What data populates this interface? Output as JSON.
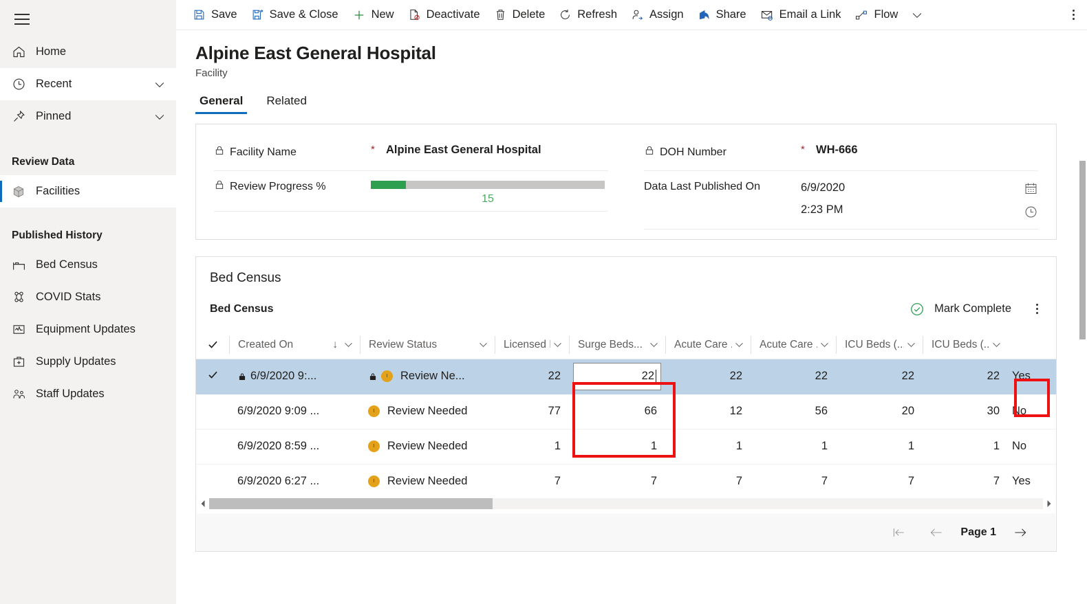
{
  "sidebar": {
    "hamburger_label": "menu-toggle",
    "nav": [
      {
        "label": "Home",
        "icon": "home-icon",
        "chevron": false
      },
      {
        "label": "Recent",
        "icon": "clock-icon",
        "chevron": true
      },
      {
        "label": "Pinned",
        "icon": "pin-icon",
        "chevron": true
      }
    ],
    "groups": [
      {
        "title": "Review Data",
        "items": [
          {
            "label": "Facilities",
            "icon": "cube-icon",
            "selected": true
          }
        ]
      },
      {
        "title": "Published History",
        "items": [
          {
            "label": "Bed Census",
            "icon": "bed-icon",
            "selected": false
          },
          {
            "label": "COVID Stats",
            "icon": "virus-icon",
            "selected": false
          },
          {
            "label": "Equipment Updates",
            "icon": "monitor-icon",
            "selected": false
          },
          {
            "label": "Supply Updates",
            "icon": "medkit-icon",
            "selected": false
          },
          {
            "label": "Staff Updates",
            "icon": "people-icon",
            "selected": false
          }
        ]
      }
    ]
  },
  "commandbar": {
    "items": [
      {
        "label": "Save",
        "icon": "save-icon"
      },
      {
        "label": "Save & Close",
        "icon": "save-close-icon"
      },
      {
        "label": "New",
        "icon": "plus-icon"
      },
      {
        "label": "Deactivate",
        "icon": "deactivate-icon"
      },
      {
        "label": "Delete",
        "icon": "trash-icon"
      },
      {
        "label": "Refresh",
        "icon": "refresh-icon"
      },
      {
        "label": "Assign",
        "icon": "assign-person-icon"
      },
      {
        "label": "Share",
        "icon": "share-icon"
      },
      {
        "label": "Email a Link",
        "icon": "email-link-icon"
      },
      {
        "label": "Flow",
        "icon": "flow-icon"
      }
    ],
    "overflow_label": "more-commands"
  },
  "record": {
    "title": "Alpine East General Hospital",
    "subtitle": "Facility",
    "tabs": [
      {
        "label": "General",
        "active": true
      },
      {
        "label": "Related",
        "active": false
      }
    ]
  },
  "form": {
    "left": [
      {
        "label": "Facility Name",
        "locked": true,
        "required": "*",
        "value": "Alpine East General Hospital",
        "type": "text"
      },
      {
        "label": "Review Progress %",
        "locked": true,
        "required": "",
        "value": "15",
        "type": "progress",
        "percent": 15
      }
    ],
    "right": [
      {
        "label": "DOH Number",
        "locked": true,
        "required": "*",
        "value": "WH-666",
        "type": "text"
      },
      {
        "label": "Data Last Published On",
        "locked": false,
        "required": "",
        "date": "6/9/2020",
        "time": "2:23 PM",
        "type": "datetime",
        "date_icon": "calendar-icon",
        "time_icon": "clock-icon"
      }
    ]
  },
  "grid": {
    "section_title": "Bed Census",
    "subgrid_title": "Bed Census",
    "mark_complete_label": "Mark Complete",
    "mark_complete_icon": "check-circle-icon",
    "more_label": "subgrid-more-commands",
    "columns": [
      {
        "key": "check",
        "label": "",
        "sort": "",
        "chevron": false,
        "type": "check"
      },
      {
        "key": "created_on",
        "label": "Created On",
        "sort": "↓",
        "chevron": true,
        "type": "text"
      },
      {
        "key": "review_status",
        "label": "Review Status",
        "sort": "",
        "chevron": true,
        "type": "text"
      },
      {
        "key": "licensed_beds",
        "label": "Licensed B...",
        "sort": "",
        "chevron": true,
        "type": "num"
      },
      {
        "key": "surge_beds",
        "label": "Surge Beds...",
        "sort": "",
        "chevron": true,
        "type": "num",
        "highlighted": true
      },
      {
        "key": "acute_care_1",
        "label": "Acute Care ...",
        "sort": "",
        "chevron": true,
        "type": "num"
      },
      {
        "key": "acute_care_2",
        "label": "Acute Care ...",
        "sort": "",
        "chevron": true,
        "type": "num"
      },
      {
        "key": "icu_beds_1",
        "label": "ICU Beds (...",
        "sort": "",
        "chevron": true,
        "type": "num"
      },
      {
        "key": "icu_beds_2",
        "label": "ICU Beds (...",
        "sort": "",
        "chevron": true,
        "type": "num"
      },
      {
        "key": "yesno",
        "label": "",
        "sort": "",
        "chevron": false,
        "type": "text"
      },
      {
        "key": "saveaction",
        "label": "",
        "sort": "",
        "chevron": false,
        "type": "save",
        "icon": "save-icon"
      }
    ],
    "rows": [
      {
        "selected": true,
        "checked": true,
        "locked_date": true,
        "locked_status": true,
        "created_on": "6/9/2020 9:...",
        "review_status": "Review Ne...",
        "status_icon": "clock-badge-icon",
        "licensed_beds": "22",
        "surge_beds": "22",
        "surge_beds_editing": true,
        "acute_care_1": "22",
        "acute_care_2": "22",
        "icu_beds_1": "22",
        "icu_beds_2": "22",
        "yesno": "Yes"
      },
      {
        "selected": false,
        "checked": false,
        "locked_date": false,
        "locked_status": false,
        "created_on": "6/9/2020 9:09 ...",
        "review_status": "Review Needed",
        "status_icon": "clock-badge-icon",
        "licensed_beds": "77",
        "surge_beds": "66",
        "surge_beds_editing": false,
        "acute_care_1": "12",
        "acute_care_2": "56",
        "icu_beds_1": "20",
        "icu_beds_2": "30",
        "yesno": "No"
      },
      {
        "selected": false,
        "checked": false,
        "locked_date": false,
        "locked_status": false,
        "created_on": "6/9/2020 8:59 ...",
        "review_status": "Review Needed",
        "status_icon": "clock-badge-icon",
        "licensed_beds": "1",
        "surge_beds": "1",
        "surge_beds_editing": false,
        "acute_care_1": "1",
        "acute_care_2": "1",
        "icu_beds_1": "1",
        "icu_beds_2": "1",
        "yesno": "No"
      },
      {
        "selected": false,
        "checked": false,
        "locked_date": false,
        "locked_status": false,
        "created_on": "6/9/2020 6:27 ...",
        "review_status": "Review Needed",
        "status_icon": "clock-badge-icon",
        "licensed_beds": "7",
        "surge_beds": "7",
        "surge_beds_editing": false,
        "acute_care_1": "7",
        "acute_care_2": "7",
        "icu_beds_1": "7",
        "icu_beds_2": "7",
        "yesno": "Yes"
      }
    ],
    "pagination": {
      "first_label": "first-page",
      "prev_label": "previous-page",
      "page_label": "Page 1",
      "next_label": "next-page"
    }
  },
  "annotations": {
    "highlight_color": "#ee1111",
    "boxes": [
      {
        "name": "surge-beds-column-highlight"
      },
      {
        "name": "row-save-button-highlight"
      }
    ]
  },
  "colors": {
    "accent": "#0f6cbd",
    "selected_row": "#bcd2e6",
    "progress_fill": "#2e9e4f",
    "progress_text": "#4aaa5e",
    "required_star": "#a4262c",
    "status_badge": "#e3a21a",
    "mark_complete": "#2e9e4f"
  }
}
